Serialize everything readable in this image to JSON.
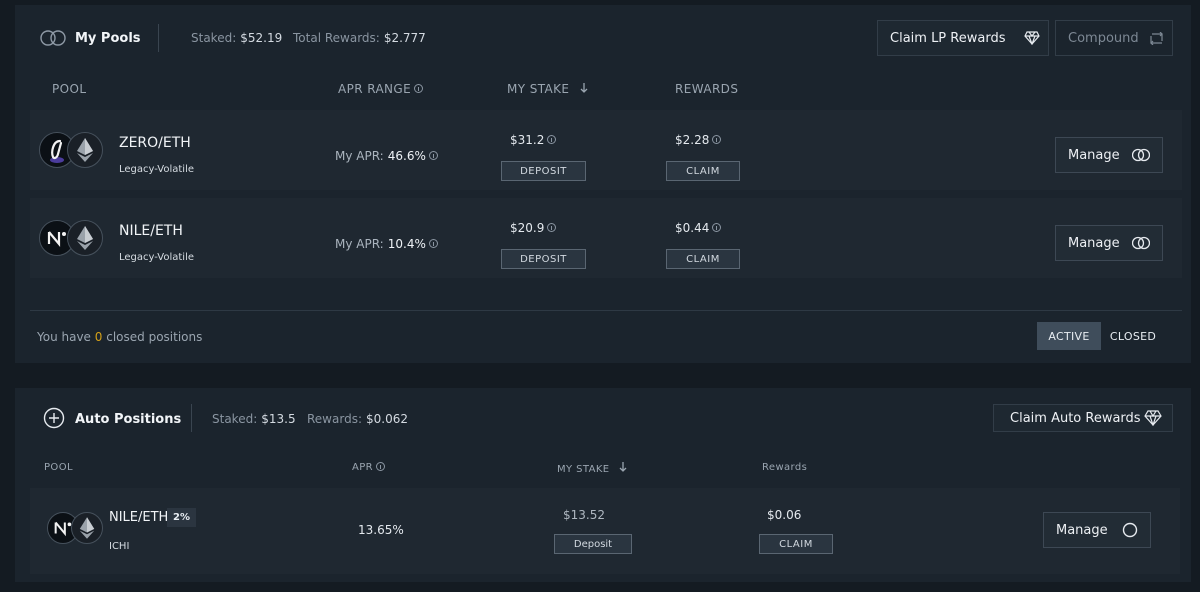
{
  "lp": {
    "title": "My Pools",
    "staked_label": "Staked:",
    "staked_value": "$52.19",
    "rewards_label": "Total Rewards:",
    "rewards_value": "$2.777",
    "claim_button": "Claim LP Rewards",
    "compound_button": "Compound",
    "columns": {
      "pool": "POOL",
      "apr": "APR RANGE",
      "stake": "MY STAKE",
      "rewards": "REWARDS"
    },
    "rows": [
      {
        "pair": "ZERO/ETH",
        "type": "Legacy-Volatile",
        "apr_label": "My APR:",
        "apr_value": "46.6%",
        "stake": "$31.2",
        "deposit": "DEPOSIT",
        "rewards": "$2.28",
        "claim": "CLAIM",
        "manage": "Manage",
        "token_a_icon": "zero-token-icon",
        "token_b_icon": "eth-token-icon"
      },
      {
        "pair": "NILE/ETH",
        "type": "Legacy-Volatile",
        "apr_label": "My APR:",
        "apr_value": "10.4%",
        "stake": "$20.9",
        "deposit": "DEPOSIT",
        "rewards": "$0.44",
        "claim": "CLAIM",
        "manage": "Manage",
        "token_a_icon": "nile-token-icon",
        "token_b_icon": "eth-token-icon"
      }
    ],
    "closed_prefix": "You have",
    "closed_count": "0",
    "closed_suffix": "closed positions",
    "filter_active": "ACTIVE",
    "filter_closed": "CLOSED",
    "selected_filter": "ACTIVE"
  },
  "auto": {
    "title": "Auto Positions",
    "staked_label": "Staked:",
    "staked_value": "$13.5",
    "rewards_label": "Rewards:",
    "rewards_value": "$0.062",
    "claim_button": "Claim Auto Rewards",
    "columns": {
      "pool": "POOL",
      "apr": "APR",
      "stake": "MY STAKE",
      "rewards": "Rewards"
    },
    "row": {
      "pair": "NILE/ETH",
      "badge": "2%",
      "provider": "ICHI",
      "apr": "13.65%",
      "stake": "$13.52",
      "deposit": "Deposit",
      "rewards": "$0.06",
      "claim": "CLAIM",
      "manage": "Manage"
    }
  },
  "colors": {
    "background": "#141b22",
    "panel": "#1b242d",
    "row": "#1f2831",
    "accent_count": "#d4a017",
    "active_filter": "#3f4d5b"
  }
}
